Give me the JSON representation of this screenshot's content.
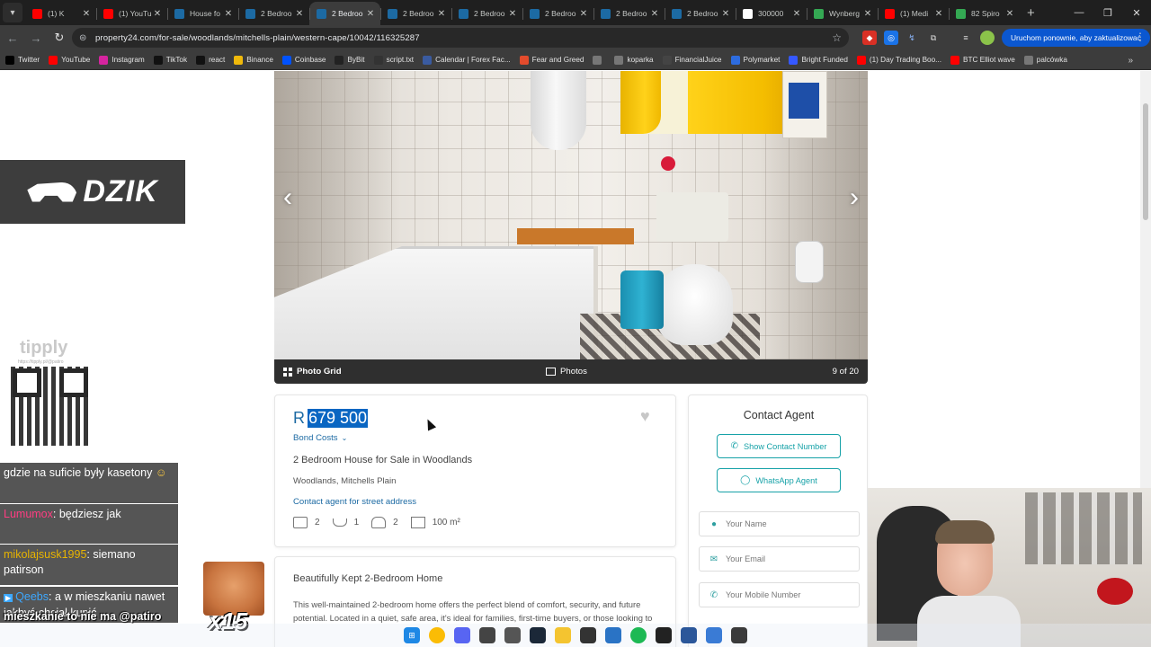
{
  "browser": {
    "tabs": [
      {
        "title": "(1) K",
        "icon": "youtube-icon",
        "color": "#ff0000",
        "active": false
      },
      {
        "title": "(1) YouTu",
        "icon": "youtube-icon",
        "color": "#ff0000",
        "active": false
      },
      {
        "title": "House fo",
        "icon": "property24-icon",
        "color": "#1c6aa3",
        "active": false
      },
      {
        "title": "2 Bedroo",
        "icon": "property24-icon",
        "color": "#1c6aa3",
        "active": false
      },
      {
        "title": "2 Bedroo",
        "icon": "property24-icon",
        "color": "#1c6aa3",
        "active": true
      },
      {
        "title": "2 Bedroo",
        "icon": "property24-icon",
        "color": "#1c6aa3",
        "active": false
      },
      {
        "title": "2 Bedroo",
        "icon": "property24-icon",
        "color": "#1c6aa3",
        "active": false
      },
      {
        "title": "2 Bedroo",
        "icon": "property24-icon",
        "color": "#1c6aa3",
        "active": false
      },
      {
        "title": "2 Bedroo",
        "icon": "property24-icon",
        "color": "#1c6aa3",
        "active": false
      },
      {
        "title": "2 Bedroo",
        "icon": "property24-icon",
        "color": "#1c6aa3",
        "active": false
      },
      {
        "title": "300000",
        "icon": "google-icon",
        "color": "#ffffff",
        "active": false
      },
      {
        "title": "Wynberg",
        "icon": "maps-pin-icon",
        "color": "#34a853",
        "active": false
      },
      {
        "title": "(1) Medi",
        "icon": "youtube-icon",
        "color": "#ff0000",
        "active": false
      },
      {
        "title": "82 Spiro",
        "icon": "maps-pin-icon",
        "color": "#34a853",
        "active": false
      }
    ],
    "url": "property24.com/for-sale/woodlands/mitchells-plain/western-cape/10042/116325287",
    "restart_label": "Uruchom ponownie, aby zaktualizować",
    "bookmarks": [
      {
        "label": "Twitter",
        "color": "#000000"
      },
      {
        "label": "YouTube",
        "color": "#ff0000"
      },
      {
        "label": "Instagram",
        "color": "#d6249f"
      },
      {
        "label": "TikTok",
        "color": "#111111"
      },
      {
        "label": "react",
        "color": "#111111"
      },
      {
        "label": "Binance",
        "color": "#f0b90b"
      },
      {
        "label": "Coinbase",
        "color": "#0052ff"
      },
      {
        "label": "ByBit",
        "color": "#222222"
      },
      {
        "label": "script.txt",
        "color": "#333333"
      },
      {
        "label": "Calendar | Forex Fac...",
        "color": "#3a5ba0"
      },
      {
        "label": "Fear and Greed",
        "color": "#e34b2c"
      },
      {
        "label": "",
        "color": "#777777"
      },
      {
        "label": "koparka",
        "color": "#777777"
      },
      {
        "label": "FinancialJuice",
        "color": "#444444"
      },
      {
        "label": "Polymarket",
        "color": "#2d6cdf"
      },
      {
        "label": "Bright Funded",
        "color": "#3558ff"
      },
      {
        "label": "(1) Day Trading Boo...",
        "color": "#ff0000"
      },
      {
        "label": "BTC Elliot wave",
        "color": "#ff0000"
      },
      {
        "label": "palcówka",
        "color": "#777777"
      }
    ]
  },
  "gallery": {
    "grid_label": "Photo Grid",
    "photos_label": "Photos",
    "counter": "9 of 20"
  },
  "listing": {
    "currency": "R",
    "price": "679 500",
    "bond_costs_label": "Bond Costs",
    "title": "2 Bedroom House for Sale in Woodlands",
    "location": "Woodlands, Mitchells Plain",
    "address_link": "Contact agent for street address",
    "features": {
      "bedrooms": "2",
      "bathrooms": "1",
      "parking": "2",
      "size": "100 m²"
    }
  },
  "description": {
    "heading": "Beautifully Kept 2-Bedroom Home",
    "body": "This well-maintained 2-bedroom home offers the perfect blend of comfort, security, and future potential. Located in a quiet, safe area, it's ideal for families, first-time buyers, or those looking to"
  },
  "contact": {
    "heading": "Contact Agent",
    "show_number": "Show Contact Number",
    "whatsapp": "WhatsApp Agent",
    "name_placeholder": "Your Name",
    "email_placeholder": "Your Email",
    "mobile_placeholder": "Your Mobile Number"
  },
  "stream": {
    "logo_text": "DZIK",
    "tip_brand": "tipply",
    "tip_url": "https://tipply.pl/@patiro",
    "chat": [
      {
        "user": "",
        "text": "gdzie na suficie były kasetony"
      },
      {
        "user": "Lumumox",
        "text": ": będziesz jak"
      },
      {
        "user": "mikolajsusk1995",
        "text": ": siemano patirson"
      },
      {
        "user": "Qeebs",
        "text": ": a w mieszkaniu nawet jakbyś chciał kupić"
      }
    ],
    "last_message": "mieszkanie to nie ma @patiro",
    "multiplier": "x15"
  }
}
